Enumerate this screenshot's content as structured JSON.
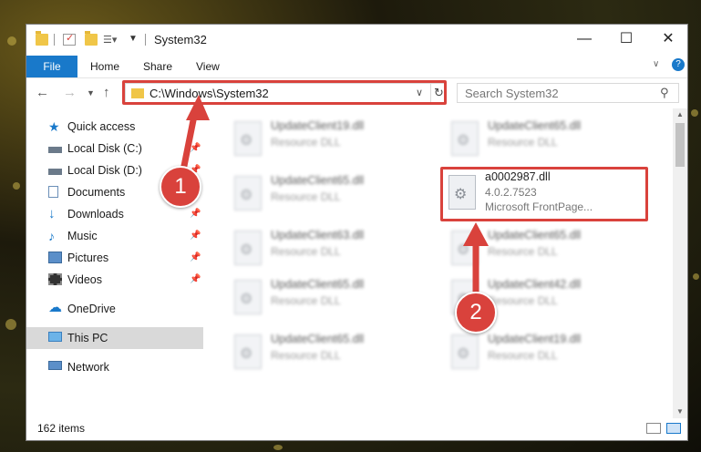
{
  "window": {
    "title": "System32"
  },
  "ribbon": {
    "tabs": [
      "File",
      "Home",
      "Share",
      "View"
    ]
  },
  "address": {
    "path": "C:\\Windows\\System32"
  },
  "search": {
    "placeholder": "Search System32"
  },
  "sidebar": {
    "items": [
      {
        "label": "Quick access",
        "icon": "star-icon",
        "pinned": false
      },
      {
        "label": "Local Disk (C:)",
        "icon": "drive-icon",
        "pinned": true
      },
      {
        "label": "Local Disk (D:)",
        "icon": "drive-icon",
        "pinned": true
      },
      {
        "label": "Documents",
        "icon": "document-icon",
        "pinned": true
      },
      {
        "label": "Downloads",
        "icon": "download-icon",
        "pinned": true
      },
      {
        "label": "Music",
        "icon": "music-icon",
        "pinned": true
      },
      {
        "label": "Pictures",
        "icon": "pictures-icon",
        "pinned": true
      },
      {
        "label": "Videos",
        "icon": "videos-icon",
        "pinned": true
      },
      {
        "label": "OneDrive",
        "icon": "cloud-icon",
        "pinned": false
      },
      {
        "label": "This PC",
        "icon": "computer-icon",
        "pinned": false
      },
      {
        "label": "Network",
        "icon": "network-icon",
        "pinned": false
      }
    ]
  },
  "files": [
    {
      "name": "UpdateClient19.dll",
      "type": "Resource DLL"
    },
    {
      "name": "UpdateClient65.dll",
      "type": "Resource DLL"
    },
    {
      "name": "UpdateClient65.dll",
      "type": "Resource DLL"
    },
    {
      "name": "a0002987.dll",
      "version": "4.0.2.7523",
      "description": "Microsoft FrontPage..."
    },
    {
      "name": "UpdateClient63.dll",
      "type": "Resource DLL"
    },
    {
      "name": "UpdateClient65.dll",
      "type": "Resource DLL"
    },
    {
      "name": "UpdateClient65.dll",
      "type": "Resource DLL"
    },
    {
      "name": "UpdateClient42.dll",
      "type": "Resource DLL"
    },
    {
      "name": "UpdateClient65.dll",
      "type": "Resource DLL"
    },
    {
      "name": "UpdateClient19.dll",
      "type": "Resource DLL"
    }
  ],
  "status": {
    "count": "162 items"
  },
  "annotations": {
    "step1": "1",
    "step2": "2",
    "color": "#d9423c"
  }
}
